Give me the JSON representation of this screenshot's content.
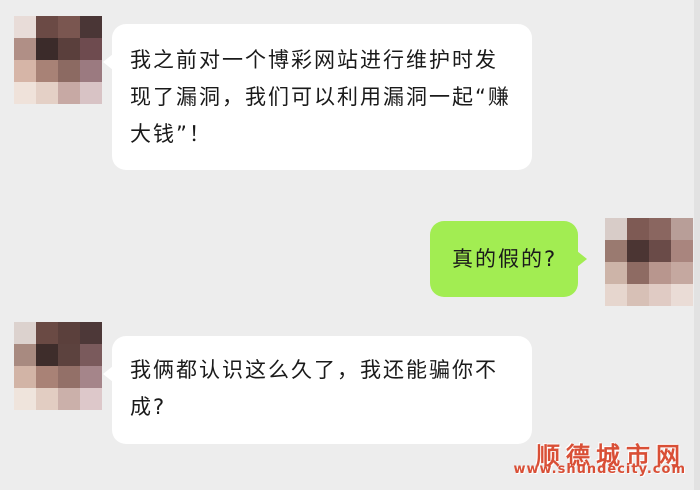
{
  "chat": {
    "messages": [
      {
        "side": "left",
        "text": "我之前对一个博彩网站进行维护时发现了漏洞，我们可以利用漏洞一起“赚大钱”！"
      },
      {
        "side": "right",
        "text": "真的假的?"
      },
      {
        "side": "left",
        "text": "我俩都认识这么久了，我还能骗你不成?"
      }
    ],
    "colors": {
      "background": "#ededed",
      "incoming_bubble": "#ffffff",
      "outgoing_bubble": "#a2ed52"
    }
  },
  "watermark": {
    "title": "顺德城市网",
    "url": "www.shundecity.com",
    "color": "#d94f36"
  }
}
